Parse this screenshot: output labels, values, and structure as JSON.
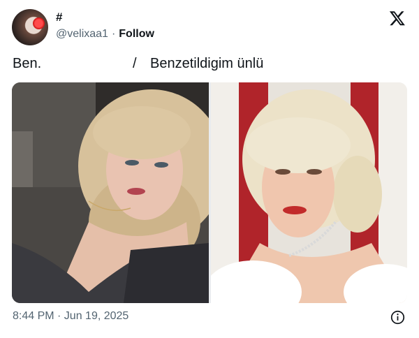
{
  "author": {
    "display_name": "#",
    "handle": "@velixaa1",
    "separator": "·",
    "follow_label": "Follow"
  },
  "tweet": {
    "text_left": "Ben.",
    "text_slash": "/",
    "text_right": "Benzetildigim ünlü",
    "timestamp": "8:44 PM · Jun 19, 2025"
  },
  "icons": {
    "brand": "x-logo-icon",
    "info": "info-icon"
  },
  "colors": {
    "text": "#0f1419",
    "secondary": "#536471"
  }
}
